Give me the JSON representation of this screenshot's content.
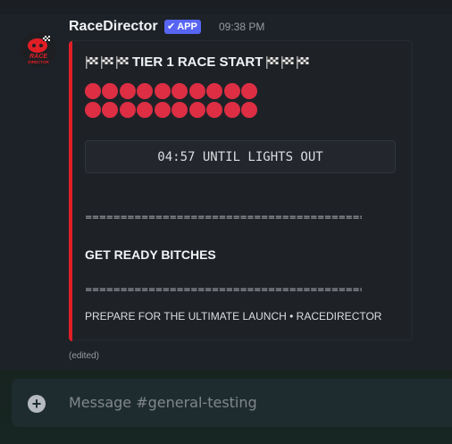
{
  "message": {
    "author": "RaceDirector",
    "badge": "APP",
    "badge_check": "✔",
    "timestamp": "09:38 PM",
    "avatar_label": "RACE DIRECTOR",
    "edited_label": "(edited)"
  },
  "embed": {
    "title": "TIER 1 RACE START",
    "accent_color": "#e01e26",
    "countdown": "04:57 UNTIL LIGHTS OUT",
    "separator": "========================================",
    "heading": "GET READY BITCHES",
    "footer": "PREPARE FOR THE ULTIMATE LAUNCH • RACEDIRECTOR",
    "dot_color": "#dd2e44",
    "icons": {
      "title_flags": "checkered-flag",
      "lights": "red-circle"
    }
  },
  "composer": {
    "placeholder": "Message #general-testing",
    "add_icon": "plus-circle-icon"
  }
}
